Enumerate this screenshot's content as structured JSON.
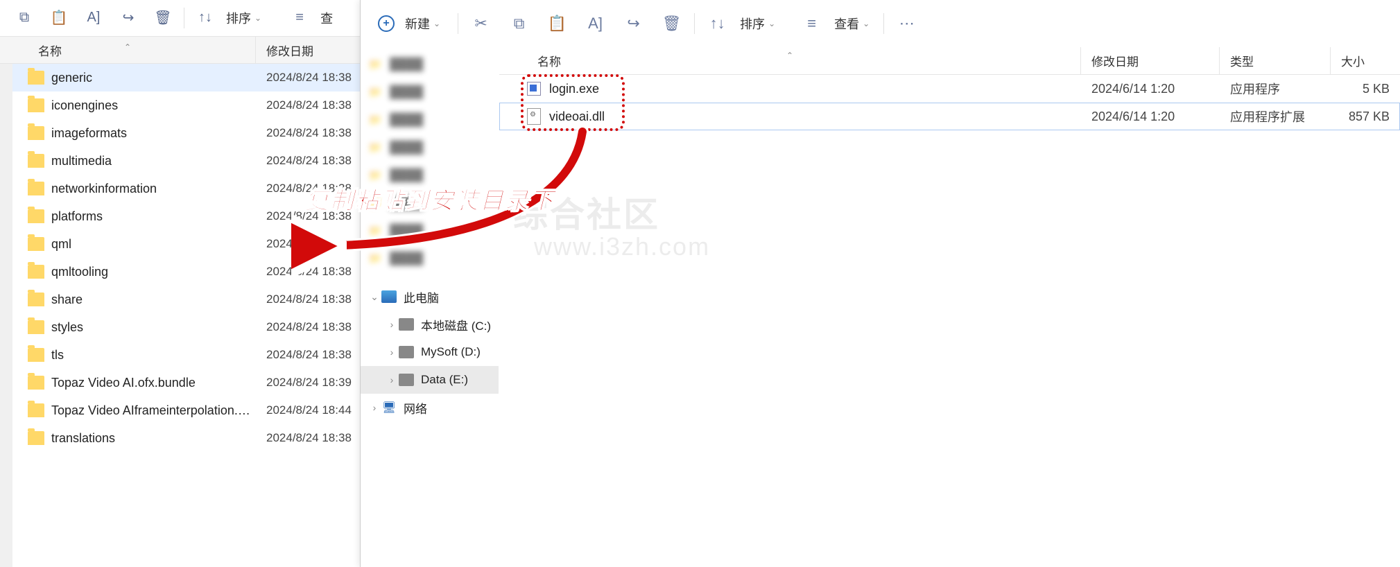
{
  "left": {
    "toolbar": {
      "sort": "排序",
      "view": "查"
    },
    "header": {
      "name": "名称",
      "date": "修改日期"
    },
    "items": [
      {
        "name": "generic",
        "date": "2024/8/24 18:38",
        "selected": true
      },
      {
        "name": "iconengines",
        "date": "2024/8/24 18:38"
      },
      {
        "name": "imageformats",
        "date": "2024/8/24 18:38"
      },
      {
        "name": "multimedia",
        "date": "2024/8/24 18:38"
      },
      {
        "name": "networkinformation",
        "date": "2024/8/24 18:38"
      },
      {
        "name": "platforms",
        "date": "2024/8/24 18:38"
      },
      {
        "name": "qml",
        "date": "2024/"
      },
      {
        "name": "qmltooling",
        "date": "2024/8/24 18:38"
      },
      {
        "name": "share",
        "date": "2024/8/24 18:38"
      },
      {
        "name": "styles",
        "date": "2024/8/24 18:38"
      },
      {
        "name": "tls",
        "date": "2024/8/24 18:38"
      },
      {
        "name": "Topaz Video AI.ofx.bundle",
        "date": "2024/8/24 18:39"
      },
      {
        "name": "Topaz Video AIframeinterpolation.ofx...",
        "date": "2024/8/24 18:44"
      },
      {
        "name": "translations",
        "date": "2024/8/24 18:38"
      }
    ]
  },
  "right": {
    "toolbar": {
      "new": "新建",
      "sort": "排序",
      "view": "查看"
    },
    "header": {
      "name": "名称",
      "date": "修改日期",
      "type": "类型",
      "size": "大小"
    },
    "nav": {
      "thispc": "此电脑",
      "c": "本地磁盘 (C:)",
      "d": "MySoft (D:)",
      "e": "Data (E:)",
      "network": "网络"
    },
    "items": [
      {
        "name": "login.exe",
        "date": "2024/6/14 1:20",
        "type": "应用程序",
        "size": "5 KB",
        "icon": "app"
      },
      {
        "name": "videoai.dll",
        "date": "2024/6/14 1:20",
        "type": "应用程序扩展",
        "size": "857 KB",
        "icon": "dll",
        "selected": true
      }
    ]
  },
  "annotation": {
    "text": "复制粘贴到安装目录下",
    "watermark1": "综合社区",
    "watermark2": "www.i3zh.com"
  }
}
